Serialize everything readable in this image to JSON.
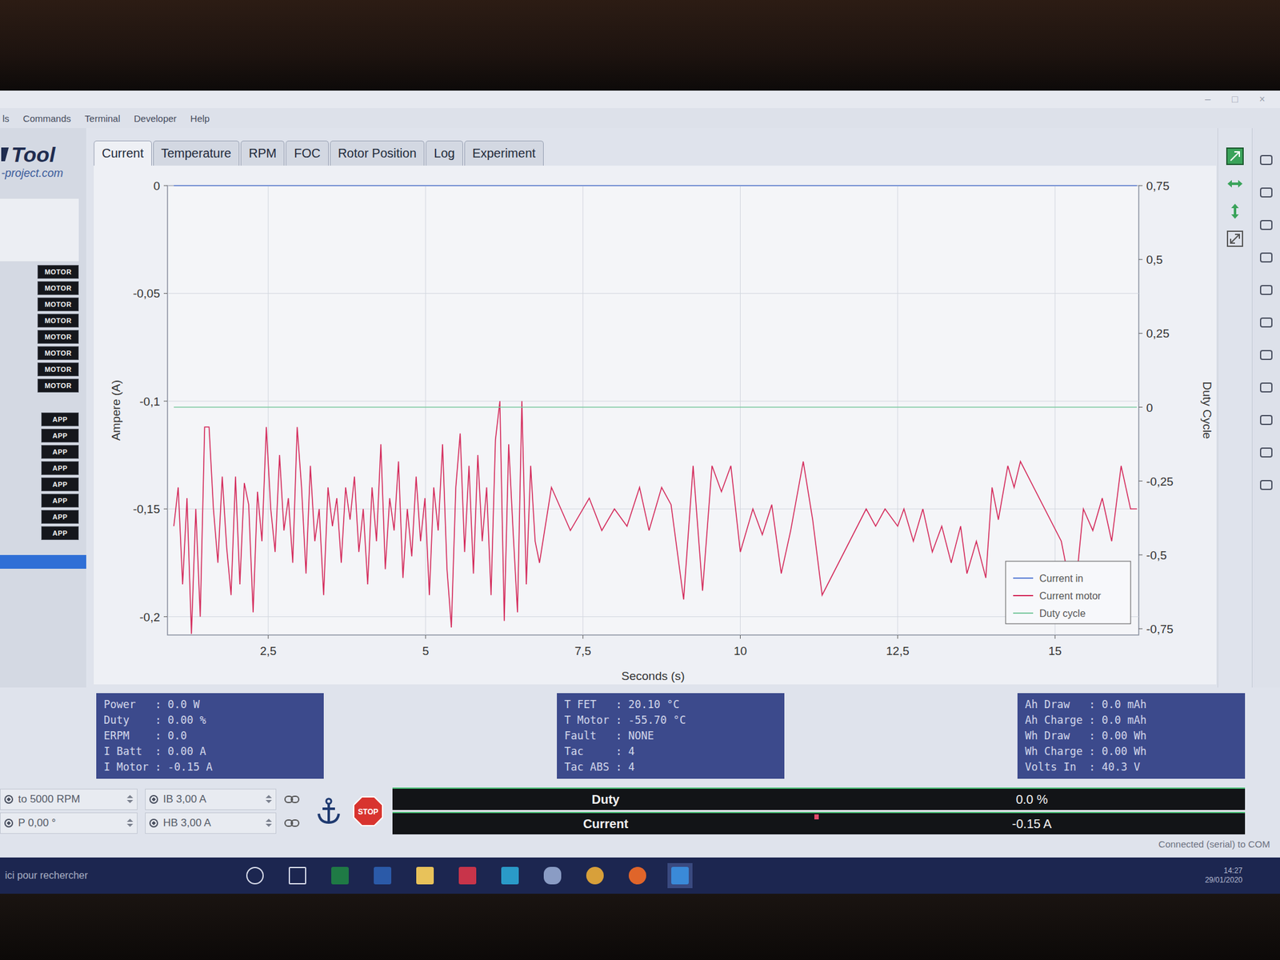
{
  "window": {
    "controls": [
      "–",
      "□",
      "×"
    ]
  },
  "menu": [
    "ls",
    "Commands",
    "Terminal",
    "Developer",
    "Help"
  ],
  "logo": {
    "name": "Tool",
    "site": "-project.com"
  },
  "tabs": [
    {
      "label": "Current",
      "selected": true
    },
    {
      "label": "Temperature",
      "selected": false
    },
    {
      "label": "RPM",
      "selected": false
    },
    {
      "label": "FOC",
      "selected": false
    },
    {
      "label": "Rotor Position",
      "selected": false
    },
    {
      "label": "Log",
      "selected": false
    },
    {
      "label": "Experiment",
      "selected": false
    }
  ],
  "sidebar": {
    "motor_buttons": [
      "MOTOR",
      "MOTOR",
      "MOTOR",
      "MOTOR",
      "MOTOR",
      "MOTOR",
      "MOTOR",
      "MOTOR"
    ],
    "app_buttons": [
      "APP",
      "APP",
      "APP",
      "APP",
      "APP",
      "APP",
      "APP",
      "APP"
    ]
  },
  "chart": {
    "y_left_label": "Ampere (A)",
    "y_right_label": "Duty Cycle",
    "x_label": "Seconds (s)",
    "y_left_ticks": [
      {
        "label": "0",
        "value": 0
      },
      {
        "label": "-0,05",
        "value": -0.05
      },
      {
        "label": "-0,1",
        "value": -0.1
      },
      {
        "label": "-0,15",
        "value": -0.15
      },
      {
        "label": "-0,2",
        "value": -0.2
      }
    ],
    "y_right_ticks": [
      {
        "label": "0,75",
        "value": 0.75
      },
      {
        "label": "0,5",
        "value": 0.5
      },
      {
        "label": "0,25",
        "value": 0.25
      },
      {
        "label": "0",
        "value": 0
      },
      {
        "label": "-0,25",
        "value": -0.25
      },
      {
        "label": "-0,5",
        "value": -0.5
      },
      {
        "label": "-0,75",
        "value": -0.75
      }
    ],
    "x_ticks": [
      {
        "label": "2,5",
        "value": 2.5
      },
      {
        "label": "5",
        "value": 5
      },
      {
        "label": "7,5",
        "value": 7.5
      },
      {
        "label": "10",
        "value": 10
      },
      {
        "label": "12,5",
        "value": 12.5
      },
      {
        "label": "15",
        "value": 15
      }
    ],
    "series": [
      {
        "name": "Current in",
        "color": "#5b7fd6",
        "axis": "left",
        "times": [
          1.0,
          16.3
        ],
        "values": [
          0,
          0
        ]
      },
      {
        "name": "Current motor",
        "color": "#d42c5c",
        "axis": "left",
        "times": [
          1.0,
          1.07,
          1.14,
          1.21,
          1.28,
          1.35,
          1.42,
          1.49,
          1.56,
          1.63,
          1.7,
          1.77,
          1.84,
          1.91,
          1.98,
          2.05,
          2.12,
          2.19,
          2.26,
          2.33,
          2.4,
          2.47,
          2.54,
          2.61,
          2.68,
          2.75,
          2.82,
          2.89,
          2.96,
          3.03,
          3.1,
          3.17,
          3.24,
          3.31,
          3.38,
          3.45,
          3.52,
          3.59,
          3.66,
          3.73,
          3.8,
          3.87,
          3.94,
          4.01,
          4.08,
          4.15,
          4.22,
          4.29,
          4.36,
          4.43,
          4.5,
          4.57,
          4.64,
          4.71,
          4.78,
          4.85,
          4.92,
          4.99,
          5.06,
          5.13,
          5.2,
          5.27,
          5.34,
          5.41,
          5.48,
          5.55,
          5.62,
          5.69,
          5.76,
          5.83,
          5.9,
          5.97,
          6.04,
          6.11,
          6.18,
          6.25,
          6.32,
          6.39,
          6.46,
          6.53,
          6.6,
          6.67,
          6.74,
          6.81,
          7.0,
          7.3,
          7.6,
          7.8,
          8.0,
          8.2,
          8.4,
          8.55,
          8.75,
          8.9,
          9.1,
          9.25,
          9.4,
          9.55,
          9.7,
          9.85,
          10.0,
          10.2,
          10.35,
          10.5,
          10.65,
          10.8,
          11.0,
          11.15,
          11.3,
          12.0,
          12.15,
          12.3,
          12.5,
          12.6,
          12.75,
          12.9,
          13.05,
          13.2,
          13.35,
          13.5,
          13.6,
          13.75,
          13.9,
          14.0,
          14.1,
          14.25,
          14.35,
          14.45,
          15.1,
          15.3,
          15.45,
          15.6,
          15.75,
          15.9,
          16.05,
          16.2,
          16.3
        ],
        "values": [
          -0.158,
          -0.14,
          -0.185,
          -0.145,
          -0.208,
          -0.15,
          -0.2,
          -0.112,
          -0.112,
          -0.15,
          -0.175,
          -0.135,
          -0.168,
          -0.19,
          -0.135,
          -0.185,
          -0.138,
          -0.148,
          -0.198,
          -0.142,
          -0.165,
          -0.112,
          -0.15,
          -0.17,
          -0.125,
          -0.16,
          -0.145,
          -0.175,
          -0.112,
          -0.14,
          -0.18,
          -0.13,
          -0.165,
          -0.15,
          -0.19,
          -0.14,
          -0.158,
          -0.145,
          -0.175,
          -0.14,
          -0.155,
          -0.135,
          -0.17,
          -0.15,
          -0.185,
          -0.14,
          -0.165,
          -0.12,
          -0.178,
          -0.145,
          -0.16,
          -0.128,
          -0.182,
          -0.15,
          -0.172,
          -0.135,
          -0.165,
          -0.145,
          -0.19,
          -0.14,
          -0.16,
          -0.12,
          -0.178,
          -0.205,
          -0.14,
          -0.115,
          -0.17,
          -0.13,
          -0.18,
          -0.125,
          -0.165,
          -0.14,
          -0.19,
          -0.118,
          -0.1,
          -0.202,
          -0.12,
          -0.16,
          -0.198,
          -0.1,
          -0.185,
          -0.13,
          -0.165,
          -0.175,
          -0.14,
          -0.16,
          -0.145,
          -0.16,
          -0.15,
          -0.158,
          -0.14,
          -0.16,
          -0.14,
          -0.148,
          -0.192,
          -0.13,
          -0.188,
          -0.13,
          -0.142,
          -0.13,
          -0.17,
          -0.15,
          -0.162,
          -0.148,
          -0.18,
          -0.16,
          -0.128,
          -0.155,
          -0.19,
          -0.15,
          -0.158,
          -0.15,
          -0.158,
          -0.15,
          -0.165,
          -0.15,
          -0.17,
          -0.158,
          -0.175,
          -0.158,
          -0.18,
          -0.165,
          -0.182,
          -0.14,
          -0.155,
          -0.13,
          -0.14,
          -0.128,
          -0.165,
          -0.195,
          -0.15,
          -0.16,
          -0.145,
          -0.165,
          -0.13,
          -0.15,
          -0.15
        ]
      },
      {
        "name": "Duty cycle",
        "color": "#7cc9a0",
        "axis": "right",
        "times": [
          1.0,
          16.3
        ],
        "values": [
          0,
          0
        ]
      }
    ]
  },
  "info_panels": [
    {
      "lines": [
        "Power   : 0.0 W",
        "Duty    : 0.00 %",
        "ERPM    : 0.0",
        "I Batt  : 0.00 A",
        "I Motor : -0.15 A"
      ]
    },
    {
      "lines": [
        "T FET   : 20.10 °C",
        "T Motor : -55.70 °C",
        "Fault   : NONE",
        "Tac     : 4",
        "Tac ABS : 4"
      ]
    },
    {
      "lines": [
        "Ah Draw   : 0.0 mAh",
        "Ah Charge : 0.0 mAh",
        "Wh Draw   : 0.00 Wh",
        "Wh Charge : 0.00 Wh",
        "Volts In  : 40.3 V"
      ]
    }
  ],
  "controls": {
    "fields": [
      [
        "to 5000 RPM",
        "IB 3,00 A"
      ],
      [
        "P 0,00 °",
        "HB 3,00 A"
      ]
    ],
    "stop": "STOP"
  },
  "bars": [
    {
      "label": "Duty",
      "value": "0.0 %",
      "kind": "fill",
      "level": 0,
      "negative": false
    },
    {
      "label": "Current",
      "value": "-0.15 A",
      "kind": "centered",
      "level": 0.01,
      "negative": true
    }
  ],
  "status": "Connected (serial) to COM",
  "taskbar": {
    "search": "ici pour rechercher",
    "time": "14:27",
    "date": "29/01/2020"
  }
}
